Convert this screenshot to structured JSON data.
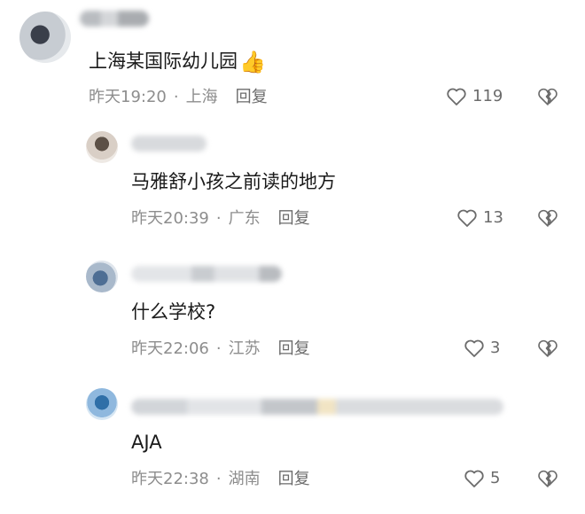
{
  "comments": [
    {
      "text": "上海某国际幼儿园",
      "emoji": "👍",
      "time": "昨天19:20",
      "location": "上海",
      "reply_label": "回复",
      "likes": "119"
    },
    {
      "text": "马雅舒小孩之前读的地方",
      "time": "昨天20:39",
      "location": "广东",
      "reply_label": "回复",
      "likes": "13"
    },
    {
      "text": "什么学校?",
      "time": "昨天22:06",
      "location": "江苏",
      "reply_label": "回复",
      "likes": "3"
    },
    {
      "text": "AJA",
      "time": "昨天22:38",
      "location": "湖南",
      "reply_label": "回复",
      "likes": "5"
    }
  ],
  "icons": {
    "like": "heart-outline-icon",
    "dislike": "broken-heart-icon"
  },
  "colors": {
    "meta_text": "#8d8d8d",
    "body_text": "#1a1a1a",
    "icon": "#6b6b6b"
  }
}
